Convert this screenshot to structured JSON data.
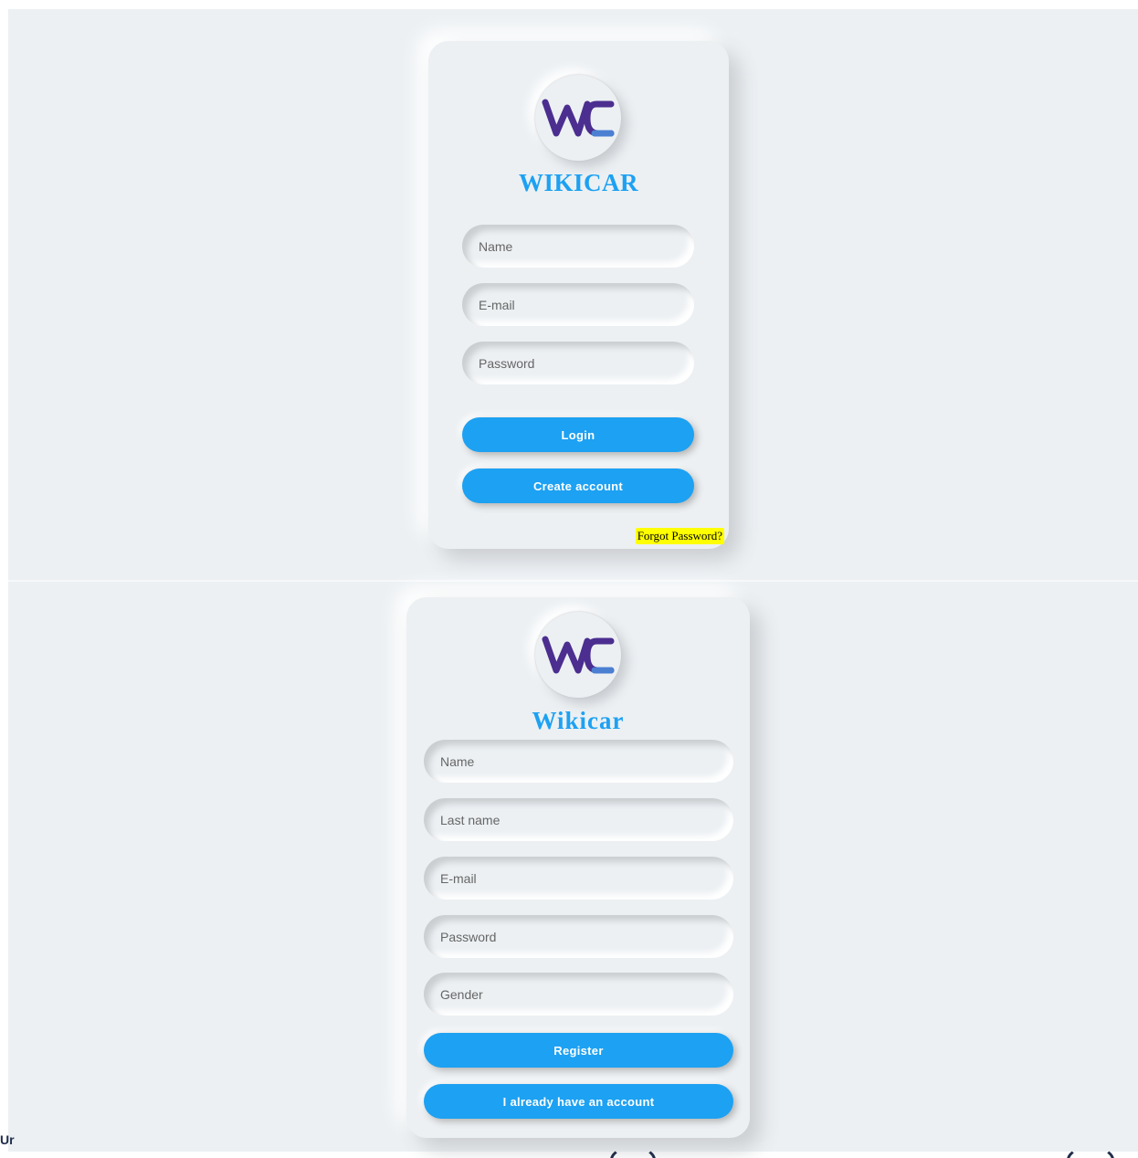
{
  "login": {
    "brand": "WIKICAR",
    "logo_text": "WC",
    "name_placeholder": "Name",
    "email_placeholder": "E-mail",
    "password_placeholder": "Password",
    "login_label": "Login",
    "create_account_label": "Create account",
    "forgot_label": "Forgot Password?"
  },
  "register": {
    "brand": "Wikicar",
    "logo_text": "WC",
    "name_placeholder": "Name",
    "last_name_placeholder": "Last name",
    "email_placeholder": "E-mail",
    "password_placeholder": "Password",
    "gender_placeholder": "Gender",
    "register_label": "Register",
    "have_account_label": "I already have an account"
  },
  "colors": {
    "accent": "#1da1f2",
    "background": "#ecf0f3",
    "logo_purple": "#4b2e8f",
    "logo_blue": "#4a7fd1",
    "highlight": "#ffff00"
  },
  "partial": {
    "corner_text": "Ur"
  }
}
